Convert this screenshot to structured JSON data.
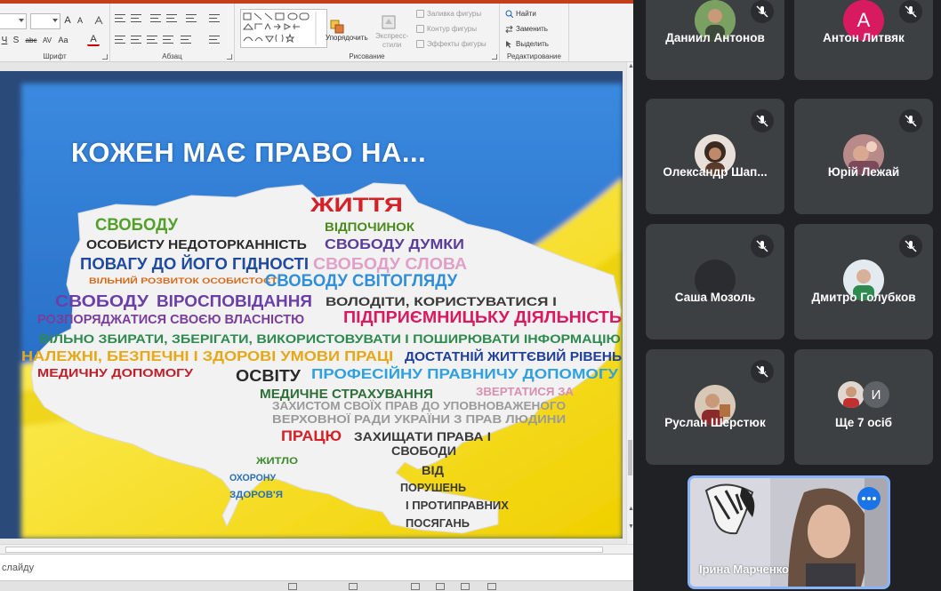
{
  "ribbon": {
    "groups": {
      "font": "Шрифт",
      "paragraph": "Абзац",
      "drawing": "Рисование",
      "editing": "Редактирование"
    },
    "font_size_glyphs": {
      "grow": "A",
      "shrink": "A",
      "clear": "A"
    },
    "drawing": {
      "arrange": "Упорядочить",
      "quick_styles_line1": "Экспресс-",
      "quick_styles_line2": "стили",
      "shape_fill": "Заливка фигуры",
      "shape_outline": "Контур фигуры",
      "shape_effects": "Эффекты фигуры"
    },
    "editing": {
      "find": "Найти",
      "replace": "Заменить",
      "select": "Выделить"
    }
  },
  "slide": {
    "title": "КОЖЕН МАЄ ПРАВО НА...",
    "colors": {
      "flag_blue": "#2f7fd8",
      "flag_yellow": "#f2e200",
      "map_fill": "#f4f4f4"
    },
    "words": [
      {
        "t": "ЖИТТЯ",
        "c": "#d62027"
      },
      {
        "t": "ВІДПОЧИНОК",
        "c": "#4b8b1e"
      },
      {
        "t": "СВОБОДУ",
        "c": "#53a02b"
      },
      {
        "t": "ОСОБИСТУ НЕДОТОРКАННІСТЬ",
        "c": "#2a2a2a"
      },
      {
        "t": "СВОБОДУ ДУМКИ",
        "c": "#5a3d9a"
      },
      {
        "t": "ПОВАГУ ДО ЙОГО ГІДНОСТІ",
        "c": "#1f4aa0"
      },
      {
        "t": "СВОБОДУ СЛОВА",
        "c": "#e0a0c8"
      },
      {
        "t": "ВІЛЬНИЙ РОЗВИТОК ОСОБИСТОСТІ",
        "c": "#d86a1a"
      },
      {
        "t": "СВОБОДУ СВІТОГЛЯДУ",
        "c": "#2f8fd8"
      },
      {
        "t": "СВОБОДУ",
        "c": "#6a3fa8"
      },
      {
        "t": "ВІРОСПОВІДАННЯ",
        "c": "#6a3fa8"
      },
      {
        "t": "ВОЛОДІТИ, КОРИСТУВАТИСЯ І",
        "c": "#3a3a3a"
      },
      {
        "t": "РОЗПОРЯДЖАТИСЯ СВОЄЮ ВЛАСНІСТЮ",
        "c": "#7a3e9a"
      },
      {
        "t": "ПІДПРИЄМНИЦЬКУ ДІЯЛЬНІСТЬ",
        "c": "#d81b60"
      },
      {
        "t": "ВІЛЬНО ЗБИРАТИ, ЗБЕРІГАТИ, ВИКОРИСТОВУВАТИ І ПОШИРЮВАТИ ІНФОРМАЦІЮ",
        "c": "#2e8a4e"
      },
      {
        "t": "НАЛЕЖНІ, БЕЗПЕЧНІ І ЗДОРОВІ УМОВИ ПРАЦІ",
        "c": "#e6a817"
      },
      {
        "t": "ДОСТАТНІЙ ЖИТТЄВИЙ РІВЕНЬ",
        "c": "#1f3f9a"
      },
      {
        "t": "МЕДИЧНУ ДОПОМОГУ",
        "c": "#c01f2a"
      },
      {
        "t": "ОСВІТУ",
        "c": "#2a2a2a"
      },
      {
        "t": "ПРОФЕСІЙНУ ПРАВНИЧУ ДОПОМОГУ",
        "c": "#2fa0e0"
      },
      {
        "t": "МЕДИЧНЕ СТРАХУВАННЯ",
        "c": "#2e6f3a"
      },
      {
        "t": "ЗВЕРТАТИСЯ ЗА",
        "c": "#d890b0"
      },
      {
        "t": "ЗАХИСТОМ СВОЇХ ПРАВ ДО УПОВНОВАЖЕНОГО",
        "c": "#9a9a9a"
      },
      {
        "t": "ВЕРХОВНОЇ РАДИ УКРАЇНИ З ПРАВ ЛЮДИНИ",
        "c": "#9a9a9a"
      },
      {
        "t": "ПРАЦЮ",
        "c": "#d62027"
      },
      {
        "t": "ЗАХИЩАТИ ПРАВА І",
        "c": "#3a3a3a"
      },
      {
        "t": "СВОБОДИ",
        "c": "#3a3a3a"
      },
      {
        "t": "ВІД",
        "c": "#3a3a3a"
      },
      {
        "t": "ПОРУШЕНЬ",
        "c": "#3a3a3a"
      },
      {
        "t": "І ПРОТИПРАВНИХ",
        "c": "#3a3a3a"
      },
      {
        "t": "ПОСЯГАНЬ",
        "c": "#3a3a3a"
      },
      {
        "t": "ЖИТЛО",
        "c": "#3a8a2a"
      },
      {
        "t": "ОХОРОНУ",
        "c": "#2a6fb0"
      },
      {
        "t": "ЗДОРОВ'Я",
        "c": "#2a6fb0"
      }
    ]
  },
  "notes": {
    "placeholder": "слайду"
  },
  "meet": {
    "participants": [
      {
        "name": "Даниил Антонов",
        "avatar": "photo",
        "color": "#6b8f5a"
      },
      {
        "name": "Антон Литвяк",
        "avatar": "letter",
        "letter": "А",
        "color": "#d81b60"
      },
      {
        "name": "Олександр Шап...",
        "avatar": "photo",
        "color": "#7a5a44"
      },
      {
        "name": "Юрій Лежай",
        "avatar": "photo",
        "color": "#a0707a"
      },
      {
        "name": "Саша Мозоль",
        "avatar": "blank",
        "color": "#2b2c2f"
      },
      {
        "name": "Дмитро Голубков",
        "avatar": "photo",
        "color": "#c9d6e0"
      },
      {
        "name": "Руслан Шерстюк",
        "avatar": "photo",
        "color": "#b08a70"
      }
    ],
    "others": {
      "label": "Ще 7 осіб",
      "letter": "И",
      "letter_color": "#5f6368"
    },
    "self": {
      "name": "Ірина Марченко"
    }
  }
}
